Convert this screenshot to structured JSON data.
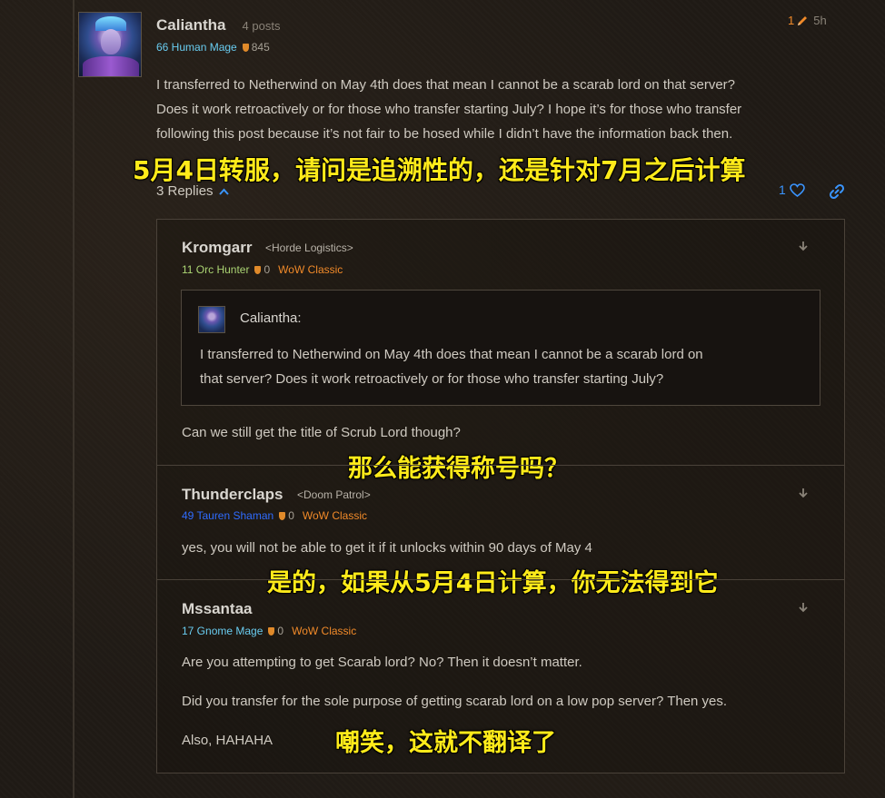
{
  "main_post": {
    "username": "Caliantha",
    "post_count": "4 posts",
    "level_class": "66 Human Mage",
    "achievement_points": "845",
    "edit_count": "1",
    "time_ago": "5h",
    "body_lines": [
      "I transferred to Netherwind on May 4th does that mean I cannot be a scarab lord on that server?",
      "Does it work retroactively or for those who transfer starting July? I hope it’s for those who transfer",
      "following this post because it’s not fair to be hosed while I didn’t have the information back then."
    ],
    "overlay": "5月4日转服，请问是追溯性的，还是针对7月之后计算",
    "replies_label": "3 Replies",
    "likes": "1"
  },
  "replies": [
    {
      "username": "Kromgarr",
      "guild": "<Horde Logistics>",
      "level_class": "11 Orc Hunter",
      "achievement_points": "0",
      "game": "WoW Classic",
      "quote": {
        "name": "Caliantha:",
        "lines": [
          "I transferred to Netherwind on May 4th does that mean I cannot be a scarab lord on",
          "that server? Does it work retroactively or for those who transfer starting July?"
        ]
      },
      "text": "Can we still get the title of Scrub Lord though?",
      "overlay": "那么能获得称号吗？"
    },
    {
      "username": "Thunderclaps",
      "guild": "<Doom Patrol>",
      "level_class": "49 Tauren Shaman",
      "achievement_points": "0",
      "game": "WoW Classic",
      "text": "yes, you will not be able to get it if it unlocks within 90 days of May 4",
      "overlay": "是的，如果从5月4日计算，你无法得到它"
    },
    {
      "username": "Mssantaa",
      "level_class": "17 Gnome Mage",
      "achievement_points": "0",
      "game": "WoW Classic",
      "lines": [
        "Are you attempting to get Scarab lord? No? Then it doesn’t matter.",
        "Did you transfer for the sole purpose of getting scarab lord on a low pop server? Then yes.",
        "Also, HAHAHA"
      ],
      "overlay": "嘲笑，这就不翻译了"
    }
  ],
  "colors": {
    "background": "#1f1a15",
    "accent_orange": "#f18a29",
    "link_blue": "#3a95ff",
    "mage": "#69ccf0",
    "hunter": "#abd473",
    "shaman": "#2f6cff",
    "overlay_yellow": "#ffeb1a"
  },
  "icons": [
    "pencil-icon",
    "chevron-up-icon",
    "heart-icon",
    "link-icon",
    "chevron-down-icon",
    "shield-icon"
  ]
}
